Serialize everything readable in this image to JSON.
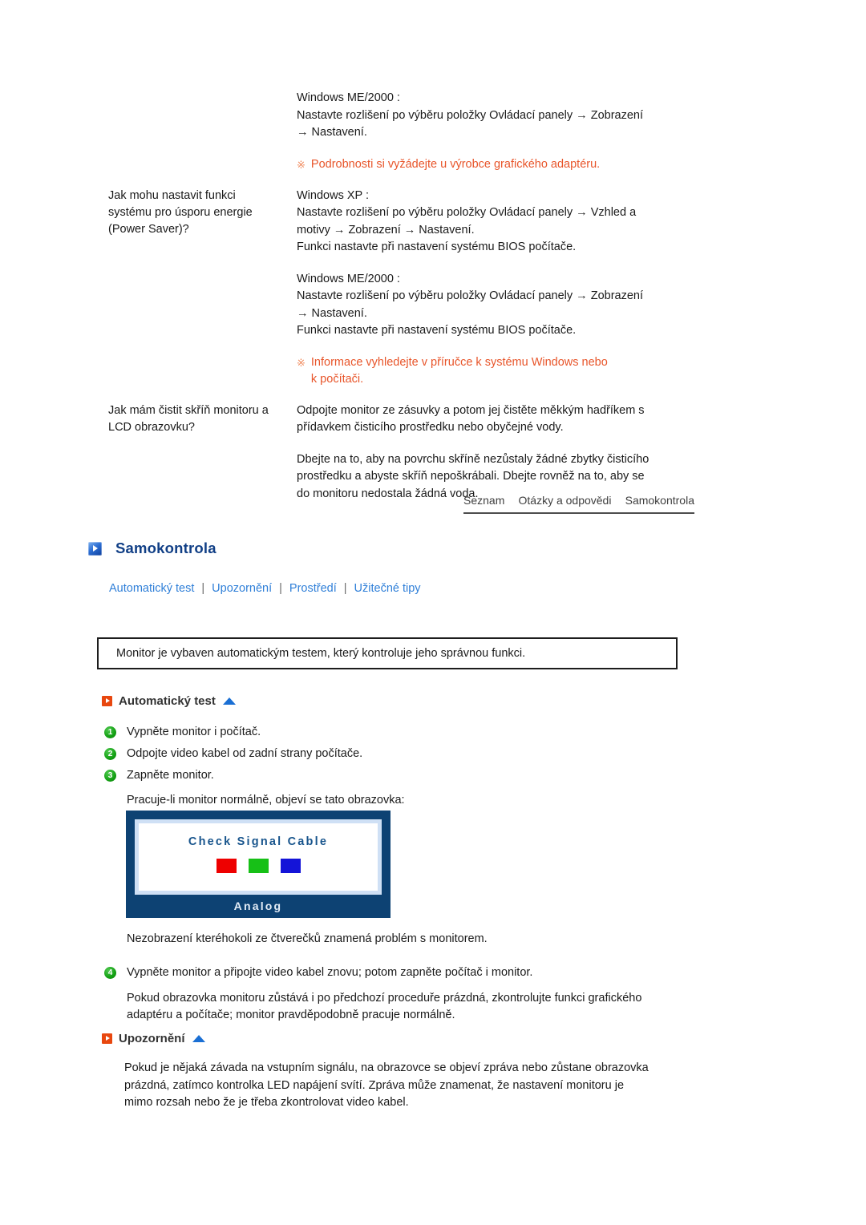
{
  "faq": {
    "rows": [
      {
        "question": "",
        "answer_lines": [
          "Windows ME/2000 :",
          "Nastavte rozlišení po výběru položky Ovládací panely → Zobrazení",
          "→ Nastavení."
        ],
        "note": "Podrobnosti si vyžádejte u výrobce grafického adaptéru.",
        "note_mark": "※"
      },
      {
        "question_lines": [
          "Jak mohu nastavit funkci",
          "systému pro úsporu energie",
          "(Power Saver)?"
        ],
        "answer_lines": [
          "Windows XP :",
          "Nastavte rozlišení po výběru položky Ovládací panely → Vzhled a",
          "motivy → Zobrazení → Nastavení.",
          "Funkci nastavte při nastavení systému BIOS počítače."
        ],
        "answer_lines2": [
          "Windows ME/2000 :",
          "Nastavte rozlišení po výběru položky Ovládací panely → Zobrazení",
          "→ Nastavení.",
          "Funkci nastavte při nastavení systému BIOS počítače."
        ],
        "note_line1": "Informace vyhledejte v příručce k systému Windows nebo",
        "note_line2": "k počítači.",
        "note_mark": "※"
      },
      {
        "question_lines": [
          "Jak mám čistit skříň monitoru a",
          "LCD obrazovku?"
        ],
        "answer_lines": [
          "Odpojte monitor ze zásuvky a potom jej čistěte měkkým hadříkem s",
          "přídavkem čisticího prostředku nebo obyčejné vody."
        ],
        "answer_lines2": [
          "Dbejte na to, aby na povrchu skříně nezůstaly žádné zbytky čisticího",
          "prostředku a abyste skříň nepoškrábali. Dbejte rovněž na to, aby se",
          "do monitoru nedostala žádná voda."
        ]
      }
    ]
  },
  "topnav": {
    "items": [
      "Seznam",
      "Otázky a odpovědi",
      "Samokontrola"
    ]
  },
  "page": {
    "title": "Samokontrola",
    "title_color": "#113f86"
  },
  "sublinks": {
    "items": [
      "Automatický test",
      "Upozornění",
      "Prostředí",
      "Užitečné tipy"
    ],
    "separator": "|",
    "color": "#2f7fd8"
  },
  "infobox": {
    "text": "Monitor je vybaven automatickým testem, který kontroluje jeho správnou funkci."
  },
  "selftest": {
    "heading": "Automatický test",
    "steps": [
      {
        "num": "1",
        "text": "Vypněte monitor i počítač."
      },
      {
        "num": "2",
        "text": "Odpojte video kabel od zadní strany počítače."
      },
      {
        "num": "3",
        "text": "Zapněte monitor."
      }
    ],
    "after_steps": "Pracuje-li monitor normálně, objeví se tato obrazovka:",
    "below_image": "Nezobrazení kteréhokoli ze čtverečků znamená problém s monitorem.",
    "step4": {
      "num": "4",
      "text": "Vypněte monitor a připojte video kabel znovu; potom zapněte počítač i monitor."
    },
    "step4_body_line1": "Pokud obrazovka monitoru zůstává i po předchozí proceduře prázdná, zkontrolujte funkci grafického",
    "step4_body_line2": "adaptéru a počítače; monitor pravděpodobně pracuje normálně."
  },
  "monitor_graphic": {
    "screen_title": "Check Signal Cable",
    "footer_label": "Analog",
    "swatch_colors": [
      "#ee0000",
      "#17c017",
      "#1414d8"
    ],
    "bezel_color": "#0d4273",
    "inner_color": "#cfe0f5",
    "title_color": "#17548c"
  },
  "warning": {
    "heading": "Upozornění",
    "body_line1": "Pokud je nějaká závada na vstupním signálu, na obrazovce se objeví zpráva nebo zůstane obrazovka",
    "body_line2": "prázdná, zatímco kontrolka LED napájení svítí. Zpráva může znamenat, že nastavení monitoru je",
    "body_line3": "mimo rozsah nebo že je třeba zkontrolovat video kabel."
  }
}
